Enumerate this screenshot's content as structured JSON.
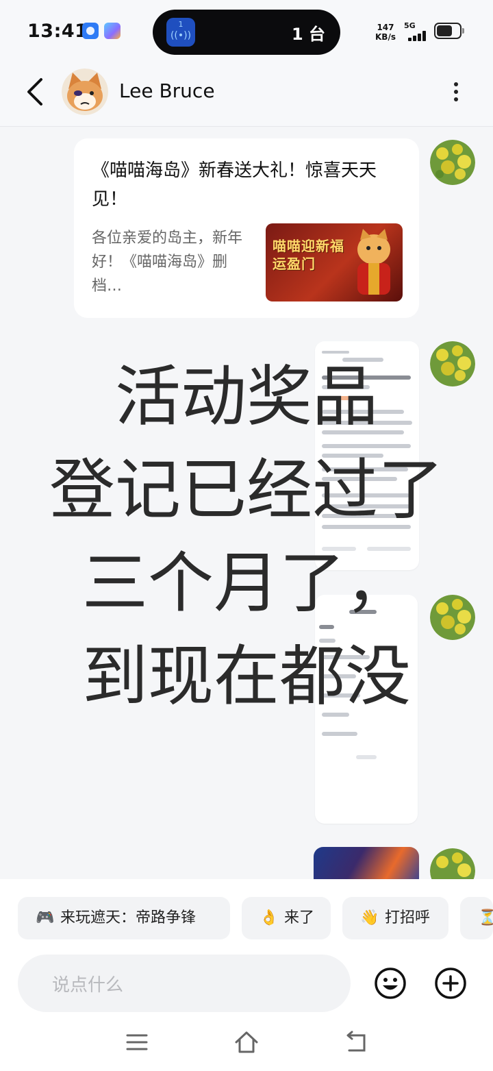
{
  "status_bar": {
    "time": "13:41",
    "island_icon_label": "1",
    "island_text": "1 台",
    "net_speed_value": "147",
    "net_speed_unit": "KB/s",
    "network": "5G"
  },
  "header": {
    "contact_name": "Lee Bruce"
  },
  "messages": {
    "card": {
      "title": "《喵喵海岛》新春送大礼！惊喜天天见！",
      "desc": "各位亲爱的岛主，新年好！《喵喵海岛》删档…",
      "thumb_text": "喵喵迎新福运盈门"
    }
  },
  "overlay": {
    "line1": "活动奖品",
    "line2": "登记已经过了",
    "line3": "三个月了，",
    "line4": "到现在都没"
  },
  "quick_replies": [
    {
      "icon": "🎮",
      "label": "来玩遮天：帝路争锋"
    },
    {
      "icon": "👌",
      "label": "来了"
    },
    {
      "icon": "👋",
      "label": "打招呼"
    },
    {
      "icon": "⏳",
      "label": ""
    }
  ],
  "composer": {
    "placeholder": "说点什么"
  },
  "colors": {
    "accent_blue": "#2f7bf5",
    "island_bg": "#0b0b0d",
    "page_bg": "#f5f6f8"
  }
}
